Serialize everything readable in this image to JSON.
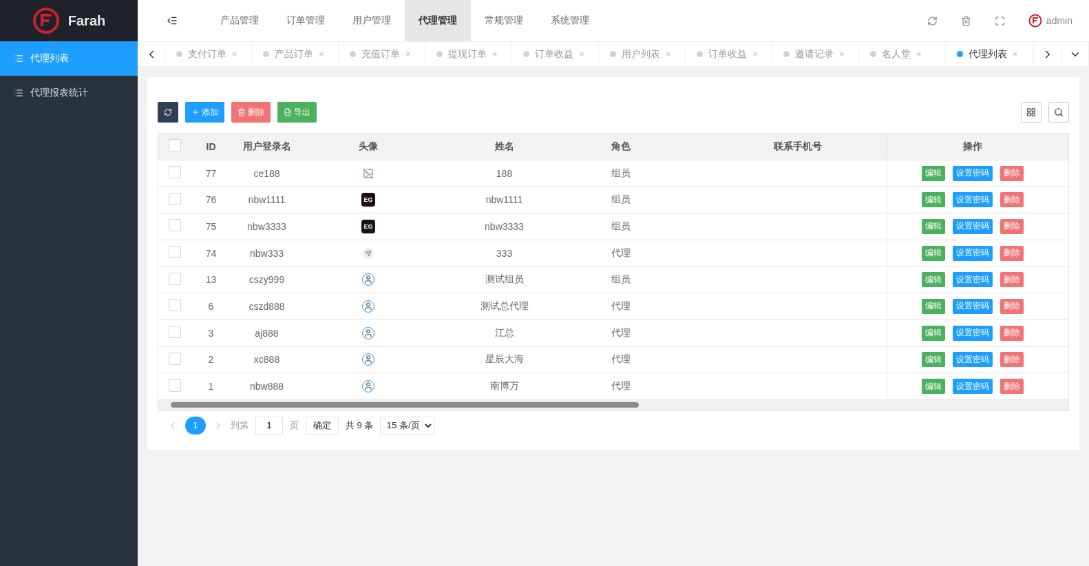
{
  "brand": {
    "name": "Farah"
  },
  "top_menu": [
    {
      "label": "产品管理",
      "selected": false
    },
    {
      "label": "订单管理",
      "selected": false
    },
    {
      "label": "用户管理",
      "selected": false
    },
    {
      "label": "代理管理",
      "selected": true
    },
    {
      "label": "常规管理",
      "selected": false
    },
    {
      "label": "系统管理",
      "selected": false
    }
  ],
  "user": {
    "name": "admin"
  },
  "sidebar": {
    "items": [
      {
        "label": "代理列表",
        "selected": true
      },
      {
        "label": "代理报表统计",
        "selected": false
      }
    ]
  },
  "tabs": [
    {
      "label": "支付订单",
      "close": "×",
      "selected": false
    },
    {
      "label": "产品订单",
      "close": "×",
      "selected": false
    },
    {
      "label": "充值订单",
      "close": "×",
      "selected": false
    },
    {
      "label": "提现订单",
      "close": "×",
      "selected": false
    },
    {
      "label": "订单收益",
      "close": "×",
      "selected": false
    },
    {
      "label": "用户列表",
      "close": "×",
      "selected": false
    },
    {
      "label": "订单收益",
      "close": "×",
      "selected": false
    },
    {
      "label": "邀请记录",
      "close": "×",
      "selected": false
    },
    {
      "label": "名人堂",
      "close": "×",
      "selected": false
    },
    {
      "label": "代理列表",
      "close": "×",
      "selected": true
    }
  ],
  "toolbar": {
    "add": "添加",
    "delete": "删除",
    "export": "导出"
  },
  "table": {
    "select_all": {
      "checked": false
    },
    "columns": [
      "ID",
      "用户登录名",
      "头像",
      "姓名",
      "角色",
      "联系手机号",
      "操作"
    ],
    "rows": [
      {
        "checked": false,
        "id": "77",
        "login": "ce188",
        "avatar": {
          "kind": "broken"
        },
        "name": "188",
        "role": "组员",
        "actions": [
          "编辑",
          "设置密码",
          "删除"
        ]
      },
      {
        "checked": false,
        "id": "76",
        "login": "nbw1111",
        "avatar": {
          "kind": "logo",
          "text": "EG"
        },
        "name": "nbw1111",
        "role": "组员",
        "actions": [
          "编辑",
          "设置密码",
          "删除"
        ]
      },
      {
        "checked": false,
        "id": "75",
        "login": "nbw3333",
        "avatar": {
          "kind": "logo",
          "text": "EG"
        },
        "name": "nbw3333",
        "role": "组员",
        "actions": [
          "编辑",
          "设置密码",
          "删除"
        ]
      },
      {
        "checked": false,
        "id": "74",
        "login": "nbw333",
        "avatar": {
          "kind": "plane"
        },
        "name": "333",
        "role": "代理",
        "actions": [
          "编辑",
          "设置密码",
          "删除"
        ]
      },
      {
        "checked": false,
        "id": "13",
        "login": "cszy999",
        "avatar": {
          "kind": "user"
        },
        "name": "测试组员",
        "role": "组员",
        "actions": [
          "编辑",
          "设置密码",
          "删除"
        ]
      },
      {
        "checked": false,
        "id": "6",
        "login": "cszd888",
        "avatar": {
          "kind": "user"
        },
        "name": "测试总代理",
        "role": "代理",
        "actions": [
          "编辑",
          "设置密码",
          "删除"
        ]
      },
      {
        "checked": false,
        "id": "3",
        "login": "aj888",
        "avatar": {
          "kind": "user"
        },
        "name": "江总",
        "role": "代理",
        "actions": [
          "编辑",
          "设置密码",
          "删除"
        ]
      },
      {
        "checked": false,
        "id": "2",
        "login": "xc888",
        "avatar": {
          "kind": "user"
        },
        "name": "星辰大海",
        "role": "代理",
        "actions": [
          "编辑",
          "设置密码",
          "删除"
        ]
      },
      {
        "checked": false,
        "id": "1",
        "login": "nbw888",
        "avatar": {
          "kind": "user"
        },
        "name": "南博万",
        "role": "代理",
        "actions": [
          "编辑",
          "设置密码",
          "删除"
        ]
      }
    ]
  },
  "pagination": {
    "pages": [
      {
        "label": "1",
        "selected": true
      }
    ],
    "goto_label": "到第",
    "page_value": "1",
    "page_unit": "页",
    "confirm": "确定",
    "total": "共 9 条",
    "page_size": "15 条/页"
  }
}
